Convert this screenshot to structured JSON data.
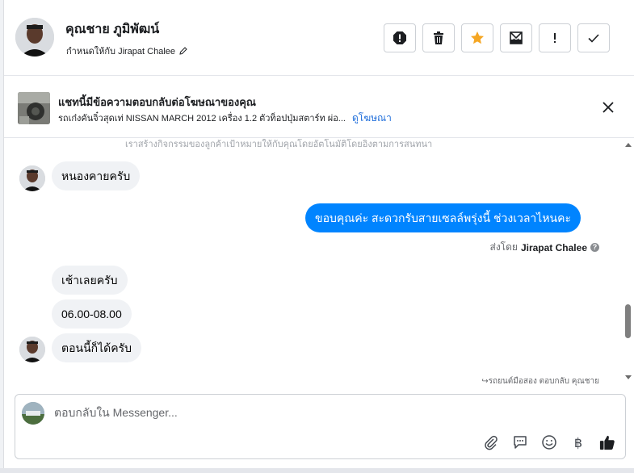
{
  "header": {
    "name": "คุณชาย ภูมิพัฒน์",
    "assigned_to": "กำหนดให้กับ Jirapat Chalee",
    "actions": [
      {
        "icon": "alert-icon",
        "label": "spam"
      },
      {
        "icon": "trash-icon",
        "label": "delete"
      },
      {
        "icon": "star-icon",
        "label": "star"
      },
      {
        "icon": "mail-icon",
        "label": "unread"
      },
      {
        "icon": "exclamation-icon",
        "label": "follow-up"
      },
      {
        "icon": "check-icon",
        "label": "done"
      }
    ]
  },
  "ad_banner": {
    "title": "แชทนี้มีข้อความตอบกลับต่อโฆษณาของคุณ",
    "description": "รถเก๋งคันจิ๋วสุดเท่ NISSAN MARCH 2012 เครื่อง 1.2 ตัวท็อปปุ่มสตาร์ท ผ่อ...",
    "link": "ดูโฆษณา"
  },
  "conversation": {
    "system_text": "เราสร้างกิจกรรมของลูกค้าเป้าหมายให้กับคุณโดยอัตโนมัติโดยอิงตามการสนทนา",
    "messages": [
      {
        "from": "customer",
        "text": "หนองคายครับ"
      },
      {
        "from": "page",
        "text": "ขอบคุณค่ะ สะดวกรับสายเซลล์พรุ่งนี้ ช่วงเวลาไหนคะ"
      },
      {
        "from": "customer",
        "text": "เช้าเลยครับ"
      },
      {
        "from": "customer",
        "text": "06.00-08.00"
      },
      {
        "from": "customer",
        "text": "ตอนนี้ก็ได้ครับ"
      }
    ],
    "sent_by_prefix": "ส่งโดย",
    "sent_by_name": "Jirapat Chalee",
    "footnote": "↪รถยนต์มือสอง ตอบกลับ คุณชาย"
  },
  "composer": {
    "placeholder": "ตอบกลับใน Messenger...",
    "tools": [
      "paperclip-icon",
      "speech-bubble-icon",
      "smiley-icon",
      "baht-icon",
      "thumbs-up-icon"
    ],
    "baht_symbol": "฿"
  }
}
